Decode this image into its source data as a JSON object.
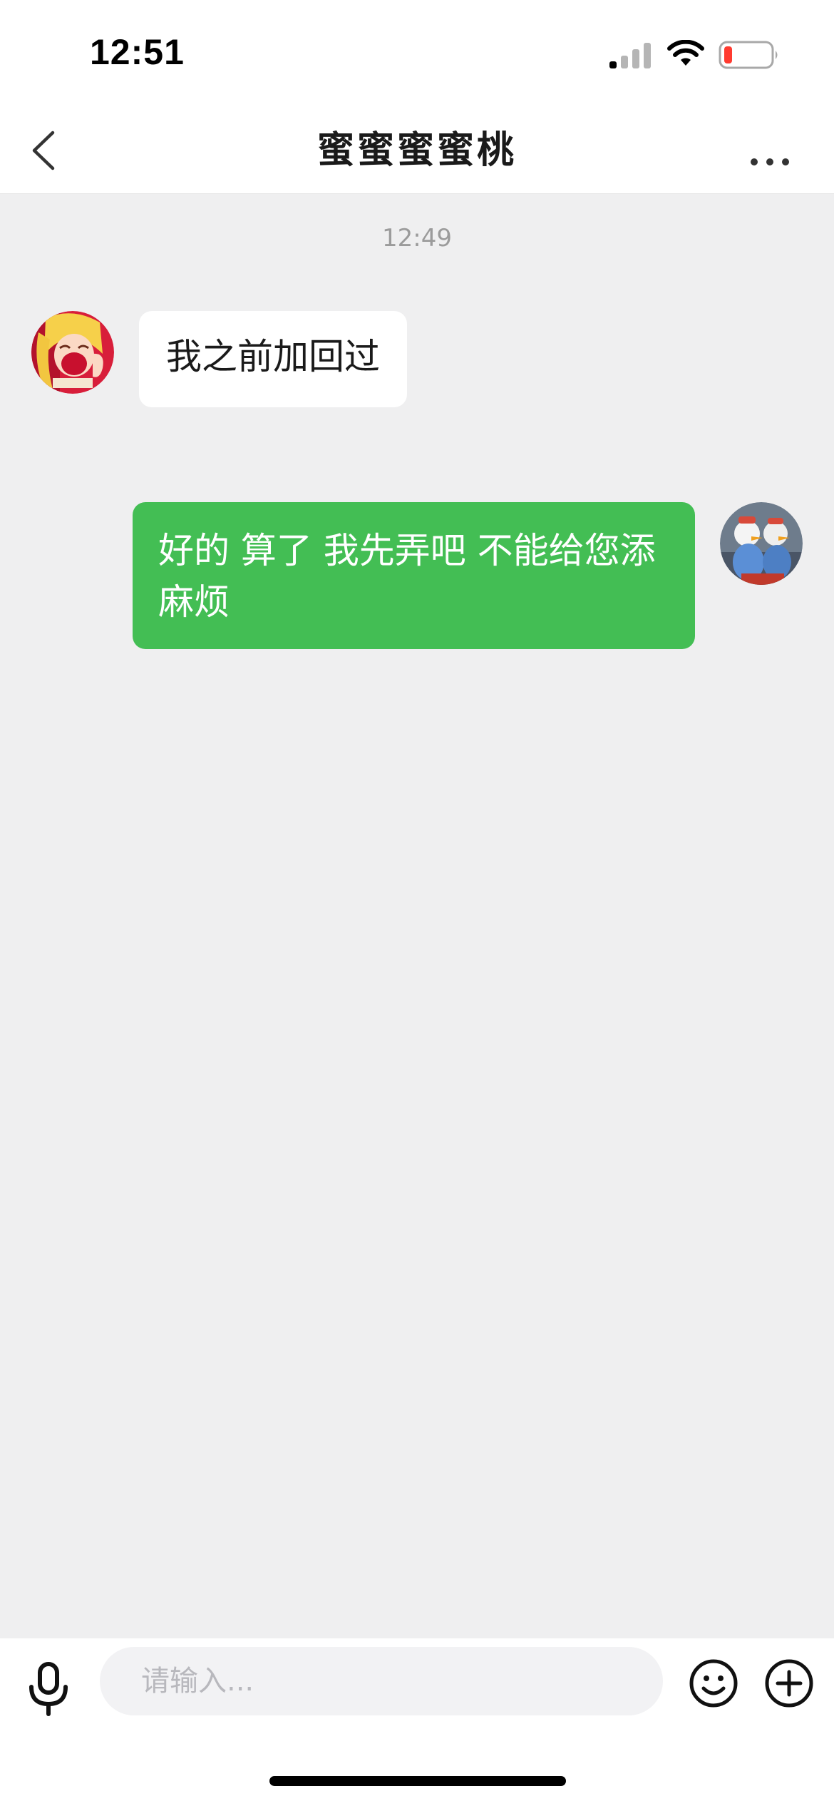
{
  "status_bar": {
    "time": "12:51",
    "signal_icon": "signal-bars-icon",
    "wifi_icon": "wifi-icon",
    "battery_icon": "battery-low-icon",
    "battery_color": "#ff3b30"
  },
  "nav": {
    "title": "蜜蜜蜜蜜桃",
    "back_icon": "chevron-left-icon",
    "more_icon": "more-dots-icon"
  },
  "chat": {
    "timestamp": "12:49",
    "messages": [
      {
        "direction": "incoming",
        "text": "我之前加回过"
      },
      {
        "direction": "outgoing",
        "text": "好的 算了 我先弄吧 不能给您添麻烦"
      }
    ]
  },
  "input_bar": {
    "placeholder": "请输入...",
    "value": "",
    "mic_icon": "microphone-icon",
    "emoji_icon": "emoji-icon",
    "plus_icon": "plus-circle-icon"
  },
  "colors": {
    "outgoing_bubble": "#43be54",
    "incoming_bubble": "#ffffff",
    "chat_background": "#efeff0"
  }
}
